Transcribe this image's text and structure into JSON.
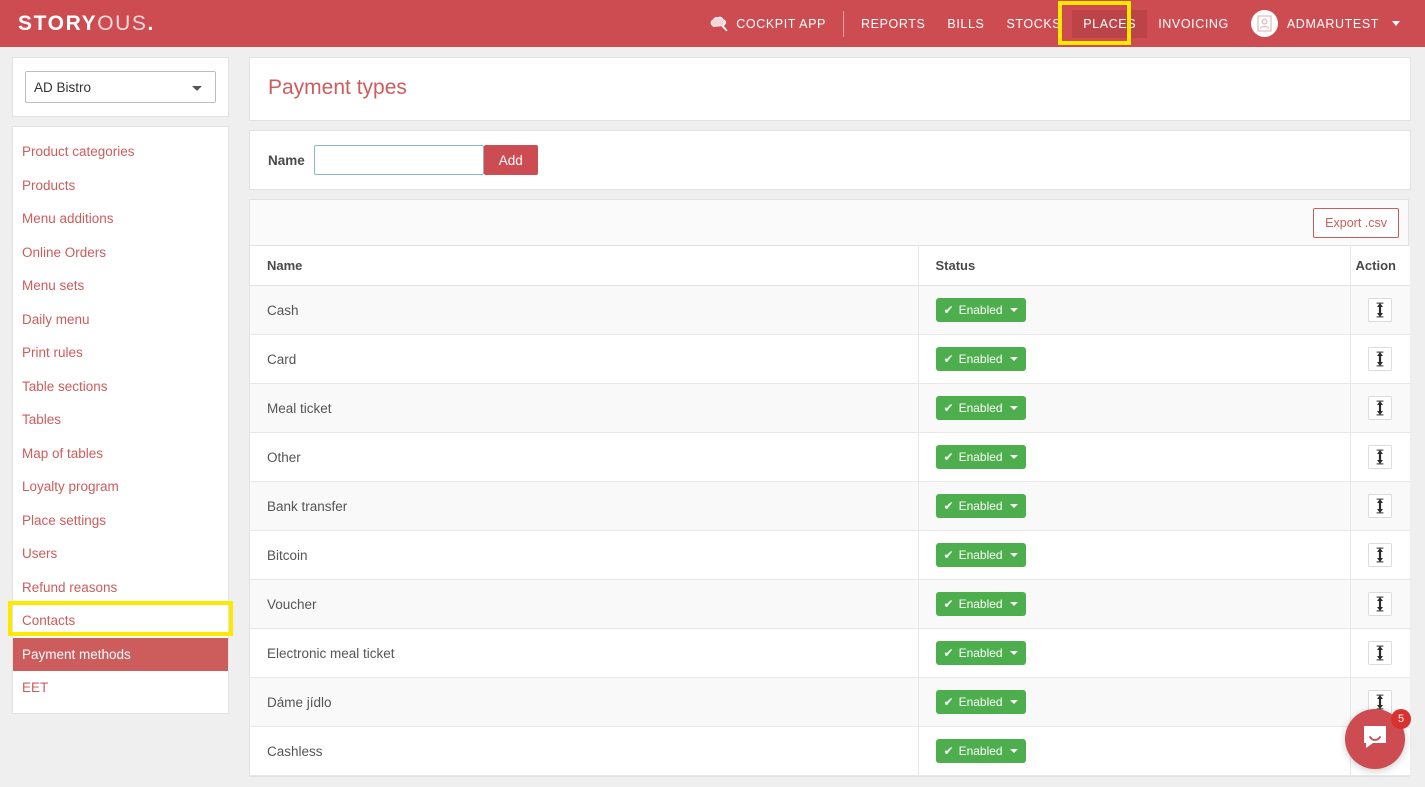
{
  "brand": {
    "logo_bold": "STORY",
    "logo_light": "OUS",
    "logo_dot": ".",
    "header_color": "#cd4c52",
    "active_nav_color": "#bc4448",
    "link_color": "#cd5c5c",
    "highlight_color": "#ffe800",
    "enabled_color": "#4cae4c"
  },
  "nav": {
    "items": [
      {
        "label": "COCKPIT APP",
        "icon": "chef-hat-icon",
        "active": false
      },
      {
        "label": "REPORTS",
        "active": false
      },
      {
        "label": "BILLS",
        "active": false
      },
      {
        "label": "STOCKS",
        "active": false
      },
      {
        "label": "PLACES",
        "active": true
      },
      {
        "label": "INVOICING",
        "active": false
      }
    ],
    "user": {
      "label": "ADMARUTEST",
      "avatar_icon": "user-card-icon",
      "caret_icon": "caret-down-icon"
    }
  },
  "sidebar": {
    "place_select": {
      "selected": "AD Bistro",
      "options": [
        "AD Bistro"
      ]
    },
    "items": [
      {
        "label": "Product categories",
        "active": false
      },
      {
        "label": "Products",
        "active": false
      },
      {
        "label": "Menu additions",
        "active": false
      },
      {
        "label": "Online Orders",
        "active": false
      },
      {
        "label": "Menu sets",
        "active": false
      },
      {
        "label": "Daily menu",
        "active": false
      },
      {
        "label": "Print rules",
        "active": false
      },
      {
        "label": "Table sections",
        "active": false
      },
      {
        "label": "Tables",
        "active": false
      },
      {
        "label": "Map of tables",
        "active": false
      },
      {
        "label": "Loyalty program",
        "active": false
      },
      {
        "label": "Place settings",
        "active": false
      },
      {
        "label": "Users",
        "active": false
      },
      {
        "label": "Refund reasons",
        "active": false
      },
      {
        "label": "Contacts",
        "active": false
      },
      {
        "label": "Payment methods",
        "active": true
      },
      {
        "label": "EET",
        "active": false
      }
    ]
  },
  "main": {
    "page_title": "Payment types",
    "add_form": {
      "label": "Name",
      "value": "",
      "placeholder": "",
      "button_label": "Add"
    },
    "toolbar": {
      "export_label": "Export .csv"
    },
    "table": {
      "columns": [
        "Name",
        "Status",
        "Action"
      ],
      "rows": [
        {
          "name": "Cash",
          "status": "Enabled",
          "action_icon": "move-updown-icon"
        },
        {
          "name": "Card",
          "status": "Enabled",
          "action_icon": "move-updown-icon"
        },
        {
          "name": "Meal ticket",
          "status": "Enabled",
          "action_icon": "move-updown-icon"
        },
        {
          "name": "Other",
          "status": "Enabled",
          "action_icon": "move-updown-icon"
        },
        {
          "name": "Bank transfer",
          "status": "Enabled",
          "action_icon": "move-updown-icon"
        },
        {
          "name": "Bitcoin",
          "status": "Enabled",
          "action_icon": "move-updown-icon"
        },
        {
          "name": "Voucher",
          "status": "Enabled",
          "action_icon": "move-updown-icon"
        },
        {
          "name": "Electronic meal ticket",
          "status": "Enabled",
          "action_icon": "move-updown-icon"
        },
        {
          "name": "Dáme jídlo",
          "status": "Enabled",
          "action_icon": "move-updown-icon"
        },
        {
          "name": "Cashless",
          "status": "Enabled",
          "action_icon": "move-updown-icon"
        }
      ]
    }
  },
  "messenger": {
    "unread_count": "5",
    "icon": "chat-bubble-icon"
  }
}
